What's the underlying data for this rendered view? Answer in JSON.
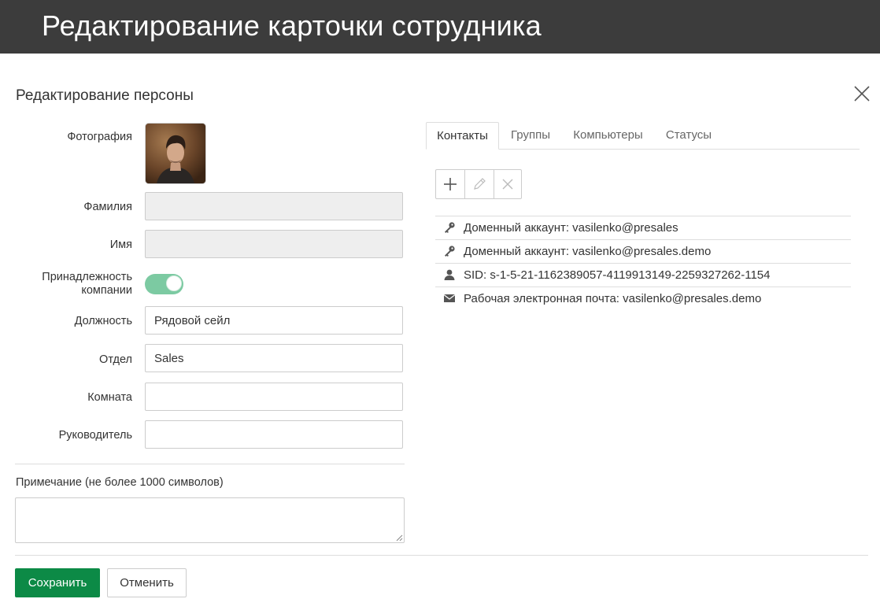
{
  "header": {
    "title": "Редактирование карточки сотрудника"
  },
  "dialog": {
    "title": "Редактирование персоны"
  },
  "form": {
    "photo_label": "Фотография",
    "lastname_label": "Фамилия",
    "lastname_value": "",
    "firstname_label": "Имя",
    "firstname_value": "",
    "company_label": "Принадлежность компании",
    "company_toggle_on": true,
    "position_label": "Должность",
    "position_value": "Рядовой сейл",
    "department_label": "Отдел",
    "department_value": "Sales",
    "room_label": "Комната",
    "room_value": "",
    "manager_label": "Руководитель",
    "manager_value": "",
    "note_label": "Примечание (не более 1000 символов)",
    "note_value": ""
  },
  "tabs": [
    {
      "label": "Контакты",
      "active": true
    },
    {
      "label": "Группы",
      "active": false
    },
    {
      "label": "Компьютеры",
      "active": false
    },
    {
      "label": "Статусы",
      "active": false
    }
  ],
  "toolbar": {
    "icons": [
      "plus-icon",
      "pencil-icon",
      "delete-icon"
    ]
  },
  "contacts": [
    {
      "icon": "key-icon",
      "text": "Доменный аккаунт: vasilenko@presales"
    },
    {
      "icon": "key-icon",
      "text": "Доменный аккаунт: vasilenko@presales.demo"
    },
    {
      "icon": "user-icon",
      "text": "SID: s-1-5-21-1162389057-4119913149-2259327262-1154"
    },
    {
      "icon": "envelope-icon",
      "text": "Рабочая электронная почта: vasilenko@presales.demo"
    }
  ],
  "footer": {
    "save_label": "Сохранить",
    "cancel_label": "Отменить"
  },
  "colors": {
    "header_bg": "#3c3c3c",
    "save_bg": "#0c8a46",
    "toggle_on": "#7ccaa2"
  }
}
